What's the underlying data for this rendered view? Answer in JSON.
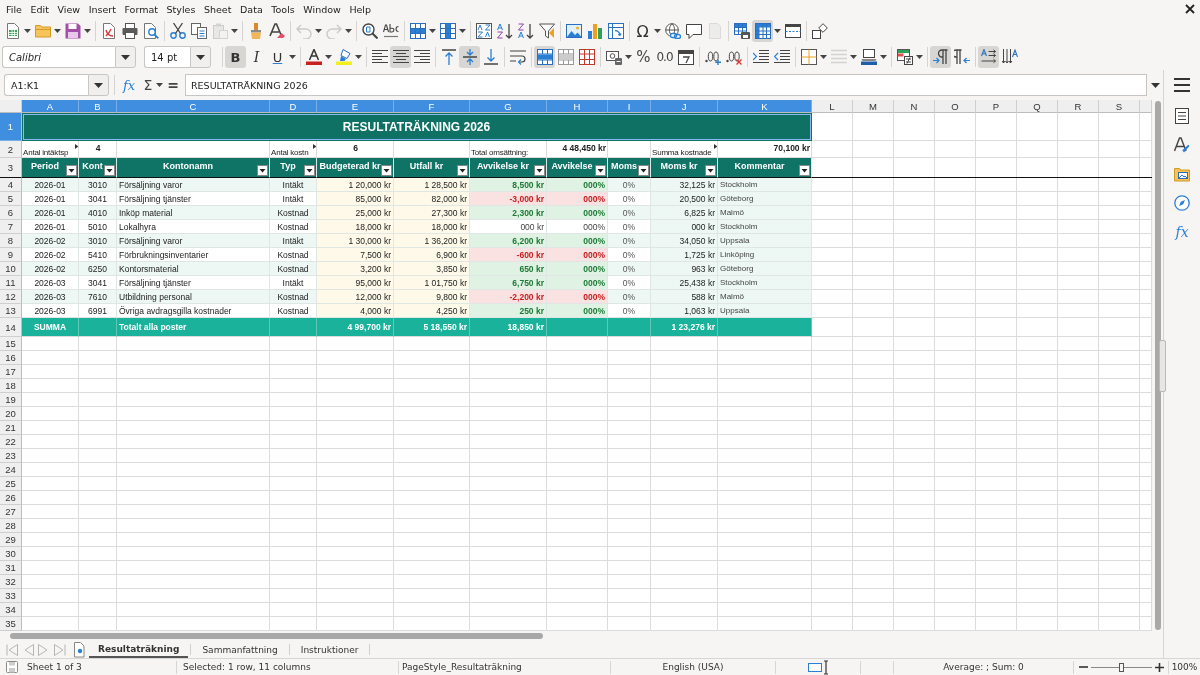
{
  "menu_bar": [
    "File",
    "Edit",
    "View",
    "Insert",
    "Format",
    "Styles",
    "Sheet",
    "Data",
    "Tools",
    "Window",
    "Help"
  ],
  "standard_toolbar": [
    [
      {
        "kind": "new",
        "pressed": false,
        "disabled": false,
        "menu": true
      },
      {
        "kind": "open",
        "pressed": false,
        "disabled": false,
        "menu": true
      },
      {
        "kind": "save",
        "pressed": false,
        "disabled": false,
        "menu": true
      }
    ],
    [
      {
        "kind": "pdf",
        "pressed": false,
        "disabled": false,
        "menu": false
      },
      {
        "kind": "print",
        "pressed": false,
        "disabled": false,
        "menu": false
      },
      {
        "kind": "preview",
        "pressed": false,
        "disabled": false,
        "menu": false
      }
    ],
    [
      {
        "kind": "cut",
        "pressed": false,
        "disabled": false,
        "menu": false
      },
      {
        "kind": "copy",
        "pressed": false,
        "disabled": false,
        "menu": false
      },
      {
        "kind": "paste",
        "pressed": false,
        "disabled": true,
        "menu": true
      }
    ],
    [
      {
        "kind": "clone",
        "pressed": false,
        "disabled": false,
        "menu": false
      },
      {
        "kind": "clear",
        "pressed": false,
        "disabled": false,
        "menu": false
      }
    ],
    [
      {
        "kind": "undo",
        "pressed": false,
        "disabled": true,
        "menu": true
      },
      {
        "kind": "redo",
        "pressed": false,
        "disabled": true,
        "menu": true
      }
    ],
    [
      {
        "kind": "find",
        "pressed": false,
        "disabled": false,
        "menu": false
      },
      {
        "kind": "spelling",
        "pressed": false,
        "disabled": false,
        "menu": false
      }
    ],
    [
      {
        "kind": "rows",
        "pressed": false,
        "disabled": false,
        "menu": true
      },
      {
        "kind": "columns",
        "pressed": false,
        "disabled": false,
        "menu": true
      }
    ],
    [
      {
        "kind": "sort",
        "pressed": false,
        "disabled": false,
        "menu": false
      },
      {
        "kind": "sortup",
        "pressed": false,
        "disabled": false,
        "menu": false
      },
      {
        "kind": "sortdown",
        "pressed": false,
        "disabled": false,
        "menu": false
      },
      {
        "kind": "autofilter",
        "pressed": false,
        "disabled": false,
        "menu": false
      }
    ],
    [
      {
        "kind": "image",
        "pressed": false,
        "disabled": false,
        "menu": false
      },
      {
        "kind": "chart",
        "pressed": false,
        "disabled": false,
        "menu": false
      },
      {
        "kind": "pivot",
        "pressed": false,
        "disabled": false,
        "menu": false
      }
    ],
    [
      {
        "kind": "special",
        "glyph": "Ω",
        "pressed": false,
        "disabled": false,
        "menu": true
      },
      {
        "kind": "hyperlink",
        "pressed": false,
        "disabled": false,
        "menu": false
      },
      {
        "kind": "comment",
        "pressed": false,
        "disabled": false,
        "menu": false
      },
      {
        "kind": "headerfooter",
        "pressed": false,
        "disabled": true,
        "menu": false
      }
    ],
    [
      {
        "kind": "printarea",
        "pressed": false,
        "disabled": false,
        "menu": false
      },
      {
        "kind": "freeze",
        "pressed": true,
        "disabled": false,
        "menu": true
      },
      {
        "kind": "splitwindow",
        "pressed": false,
        "disabled": false,
        "menu": false
      }
    ],
    [
      {
        "kind": "draw",
        "pressed": false,
        "disabled": false,
        "menu": false
      }
    ]
  ],
  "formatting_toolbar": {
    "font_name": "Calibri",
    "font_size": "14 pt",
    "groups": [
      [
        {
          "kind": "bold",
          "glyph": "B",
          "pressed": true,
          "disabled": false,
          "menu": false
        },
        {
          "kind": "italic",
          "glyph": "I",
          "pressed": false,
          "disabled": false,
          "menu": false
        },
        {
          "kind": "underline",
          "glyph": "U",
          "pressed": false,
          "disabled": false,
          "menu": true
        }
      ],
      [
        {
          "kind": "fontcolor",
          "pressed": false,
          "disabled": false,
          "menu": true
        },
        {
          "kind": "highlight",
          "pressed": false,
          "disabled": false,
          "menu": true
        }
      ],
      [
        {
          "kind": "alignleft",
          "pressed": false,
          "disabled": false,
          "menu": false
        },
        {
          "kind": "aligncenter",
          "pressed": true,
          "disabled": false,
          "menu": false
        },
        {
          "kind": "alignright",
          "pressed": false,
          "disabled": false,
          "menu": false
        }
      ],
      [
        {
          "kind": "aligntop",
          "pressed": false,
          "disabled": false,
          "menu": false
        },
        {
          "kind": "alignmiddle",
          "pressed": true,
          "disabled": false,
          "menu": false
        },
        {
          "kind": "alignbottom",
          "pressed": false,
          "disabled": false,
          "menu": false
        }
      ],
      [
        {
          "kind": "wrap",
          "pressed": false,
          "disabled": false,
          "menu": false
        }
      ],
      [
        {
          "kind": "mergecenter",
          "pressed": true,
          "disabled": false,
          "menu": false
        },
        {
          "kind": "merge",
          "pressed": false,
          "disabled": false,
          "menu": false
        },
        {
          "kind": "unmerge",
          "pressed": false,
          "disabled": false,
          "menu": false
        }
      ],
      [
        {
          "kind": "currency",
          "pressed": false,
          "disabled": false,
          "menu": true
        },
        {
          "kind": "percent",
          "glyph": "%",
          "pressed": false,
          "disabled": false,
          "menu": false
        },
        {
          "kind": "number",
          "glyph": "0.0",
          "pressed": false,
          "disabled": false,
          "menu": false
        },
        {
          "kind": "date",
          "pressed": false,
          "disabled": false,
          "menu": false
        }
      ],
      [
        {
          "kind": "adddecimal",
          "pressed": false,
          "disabled": false,
          "menu": false
        },
        {
          "kind": "deldecimal",
          "pressed": false,
          "disabled": false,
          "menu": false
        }
      ],
      [
        {
          "kind": "indent",
          "pressed": false,
          "disabled": false,
          "menu": false
        },
        {
          "kind": "outdent",
          "pressed": false,
          "disabled": false,
          "menu": false
        }
      ],
      [
        {
          "kind": "borders",
          "pressed": false,
          "disabled": false,
          "menu": true
        },
        {
          "kind": "borderstyle",
          "pressed": false,
          "disabled": true,
          "menu": true
        },
        {
          "kind": "bordercolor",
          "pressed": false,
          "disabled": false,
          "menu": true
        }
      ],
      [
        {
          "kind": "conditional",
          "pressed": false,
          "disabled": false,
          "menu": true
        }
      ],
      [
        {
          "kind": "ltr",
          "pressed": true,
          "disabled": false,
          "menu": false
        },
        {
          "kind": "rtl",
          "pressed": false,
          "disabled": false,
          "menu": false
        }
      ],
      [
        {
          "kind": "horizontal",
          "pressed": true,
          "disabled": false,
          "menu": false
        },
        {
          "kind": "vertical",
          "pressed": false,
          "disabled": false,
          "menu": false
        }
      ]
    ]
  },
  "formula_bar": {
    "name_box": "A1:K1",
    "function_glyph": "fx",
    "sum_glyph": "Σ",
    "formula_glyph": "=",
    "content": "RESULTATRÄKNING 2026"
  },
  "sidebar": [
    {
      "kind": "menu"
    },
    {
      "kind": "properties"
    },
    {
      "kind": "styles"
    },
    {
      "kind": "gallery"
    },
    {
      "kind": "navigator"
    },
    {
      "kind": "functions",
      "glyph": "fx"
    }
  ],
  "sheet": {
    "columns": [
      {
        "label": "A",
        "selected": true
      },
      {
        "label": "B",
        "selected": true
      },
      {
        "label": "C",
        "selected": true
      },
      {
        "label": "D",
        "selected": true
      },
      {
        "label": "E",
        "selected": true
      },
      {
        "label": "F",
        "selected": true
      },
      {
        "label": "G",
        "selected": true
      },
      {
        "label": "H",
        "selected": true
      },
      {
        "label": "I",
        "selected": true
      },
      {
        "label": "J",
        "selected": true
      },
      {
        "label": "K",
        "selected": true
      },
      {
        "label": "L",
        "selected": false
      },
      {
        "label": "M",
        "selected": false
      },
      {
        "label": "N",
        "selected": false
      },
      {
        "label": "O",
        "selected": false
      },
      {
        "label": "P",
        "selected": false
      },
      {
        "label": "Q",
        "selected": false
      },
      {
        "label": "R",
        "selected": false
      },
      {
        "label": "S",
        "selected": false
      }
    ],
    "rows": [
      {
        "label": "1",
        "selected": true
      },
      {
        "label": "2",
        "selected": false
      },
      {
        "label": "3",
        "selected": false
      },
      {
        "label": "4",
        "selected": false
      },
      {
        "label": "5",
        "selected": false
      },
      {
        "label": "6",
        "selected": false
      },
      {
        "label": "7",
        "selected": false
      },
      {
        "label": "8",
        "selected": false
      },
      {
        "label": "9",
        "selected": false
      },
      {
        "label": "10",
        "selected": false
      },
      {
        "label": "11",
        "selected": false
      },
      {
        "label": "12",
        "selected": false
      },
      {
        "label": "13",
        "selected": false
      },
      {
        "label": "14",
        "selected": false
      },
      {
        "label": "15",
        "selected": false
      },
      {
        "label": "16",
        "selected": false
      },
      {
        "label": "17",
        "selected": false
      },
      {
        "label": "18",
        "selected": false
      },
      {
        "label": "19",
        "selected": false
      },
      {
        "label": "20",
        "selected": false
      },
      {
        "label": "21",
        "selected": false
      },
      {
        "label": "22",
        "selected": false
      },
      {
        "label": "23",
        "selected": false
      },
      {
        "label": "24",
        "selected": false
      },
      {
        "label": "25",
        "selected": false
      },
      {
        "label": "26",
        "selected": false
      },
      {
        "label": "27",
        "selected": false
      },
      {
        "label": "28",
        "selected": false
      },
      {
        "label": "29",
        "selected": false
      },
      {
        "label": "30",
        "selected": false
      },
      {
        "label": "31",
        "selected": false
      },
      {
        "label": "32",
        "selected": false
      },
      {
        "label": "33",
        "selected": false
      },
      {
        "label": "34",
        "selected": false
      },
      {
        "label": "35",
        "selected": false
      }
    ],
    "title": {
      "text": "RESULTATRÄKNING 2026",
      "selected": true
    },
    "summary": [
      {
        "label": "Antal intäktsp",
        "clipped": true,
        "kind": "count",
        "value": "4"
      },
      {
        "label": "Antal kostn",
        "clipped": true,
        "kind": "count",
        "value": "6"
      },
      {
        "label": "Total omsättning:",
        "clipped": false,
        "kind": "amount",
        "value": "4 48,450 kr"
      },
      {
        "label": "Summa kostnade",
        "clipped": true,
        "kind": "amount",
        "value": "70,100 kr"
      }
    ],
    "table": {
      "columns": [
        {
          "label": "Period"
        },
        {
          "label": "Kont"
        },
        {
          "label": "Kontonamn"
        },
        {
          "label": "Typ"
        },
        {
          "label": "Budgeterad kr"
        },
        {
          "label": "Utfall kr"
        },
        {
          "label": "Avvikelse kr"
        },
        {
          "label": "Avvikelse"
        },
        {
          "label": "Moms"
        },
        {
          "label": "Moms kr"
        },
        {
          "label": "Kommentar"
        }
      ],
      "rows": [
        {
          "period": "2026-01",
          "account": "3010",
          "name": "Försäljning varor",
          "type": "Intäkt",
          "budget": "1 20,000 kr",
          "actual": "1 28,500 kr",
          "deviation": "8,500 kr",
          "deviation_pct": "000%",
          "vat_pct": "0%",
          "vat": "32,125 kr",
          "comment": "Stockholm",
          "kind": "positive"
        },
        {
          "period": "2026-01",
          "account": "3041",
          "name": "Försäljning tjänster",
          "type": "Intäkt",
          "budget": "85,000 kr",
          "actual": "82,000 kr",
          "deviation": "-3,000 kr",
          "deviation_pct": "000%",
          "vat_pct": "0%",
          "vat": "20,500 kr",
          "comment": "Göteborg",
          "kind": "negative"
        },
        {
          "period": "2026-01",
          "account": "4010",
          "name": "Inköp material",
          "type": "Kostnad",
          "budget": "25,000 kr",
          "actual": "27,300 kr",
          "deviation": "2,300 kr",
          "deviation_pct": "000%",
          "vat_pct": "0%",
          "vat": "6,825 kr",
          "comment": "Malmö",
          "kind": "positive"
        },
        {
          "period": "2026-01",
          "account": "5010",
          "name": "Lokalhyra",
          "type": "Kostnad",
          "budget": "18,000 kr",
          "actual": "18,000 kr",
          "deviation": "000 kr",
          "deviation_pct": "000%",
          "vat_pct": "0%",
          "vat": "000 kr",
          "comment": "Stockholm",
          "kind": "zero"
        },
        {
          "period": "2026-02",
          "account": "3010",
          "name": "Försäljning varor",
          "type": "Intäkt",
          "budget": "1 30,000 kr",
          "actual": "1 36,200 kr",
          "deviation": "6,200 kr",
          "deviation_pct": "000%",
          "vat_pct": "0%",
          "vat": "34,050 kr",
          "comment": "Uppsala",
          "kind": "positive"
        },
        {
          "period": "2026-02",
          "account": "5410",
          "name": "Förbrukningsinventarier",
          "type": "Kostnad",
          "budget": "7,500 kr",
          "actual": "6,900 kr",
          "deviation": "-600 kr",
          "deviation_pct": "000%",
          "vat_pct": "0%",
          "vat": "1,725 kr",
          "comment": "Linköping",
          "kind": "negative"
        },
        {
          "period": "2026-02",
          "account": "6250",
          "name": "Kontorsmaterial",
          "type": "Kostnad",
          "budget": "3,200 kr",
          "actual": "3,850 kr",
          "deviation": "650 kr",
          "deviation_pct": "000%",
          "vat_pct": "0%",
          "vat": "963 kr",
          "comment": "Göteborg",
          "kind": "positive"
        },
        {
          "period": "2026-03",
          "account": "3041",
          "name": "Försäljning tjänster",
          "type": "Intäkt",
          "budget": "95,000 kr",
          "actual": "1 01,750 kr",
          "deviation": "6,750 kr",
          "deviation_pct": "000%",
          "vat_pct": "0%",
          "vat": "25,438 kr",
          "comment": "Stockholm",
          "kind": "positive"
        },
        {
          "period": "2026-03",
          "account": "7610",
          "name": "Utbildning personal",
          "type": "Kostnad",
          "budget": "12,000 kr",
          "actual": "9,800 kr",
          "deviation": "-2,200 kr",
          "deviation_pct": "000%",
          "vat_pct": "0%",
          "vat": "588 kr",
          "comment": "Malmö",
          "kind": "negative"
        },
        {
          "period": "2026-03",
          "account": "6991",
          "name": "Övriga avdragsgilla kostnader",
          "type": "Kostnad",
          "budget": "4,000 kr",
          "actual": "4,250 kr",
          "deviation": "250 kr",
          "deviation_pct": "000%",
          "vat_pct": "0%",
          "vat": "1,063 kr",
          "comment": "Uppsala",
          "kind": "positive"
        }
      ],
      "totals": {
        "label": "SUMMA",
        "description": "Totalt alla poster",
        "budget": "4 99,700 kr",
        "actual": "5 18,550 kr",
        "deviation": "18,850 kr",
        "vat": "1 23,276 kr"
      }
    }
  },
  "sheet_tabs": [
    {
      "label": "Resultaträkning",
      "selected": true
    },
    {
      "label": "Sammanfattning",
      "selected": false
    },
    {
      "label": "Instruktioner",
      "selected": false
    }
  ],
  "status_bar": {
    "sheet_position": "Sheet 1 of 3",
    "selection": "Selected: 1 row, 11 columns",
    "page_style": "PageStyle_Resultaträkning",
    "language": "English (USA)",
    "statistics": "Average: ; Sum: 0",
    "zoom_slider": {
      "level": 0.5
    },
    "zoom": "100%"
  }
}
